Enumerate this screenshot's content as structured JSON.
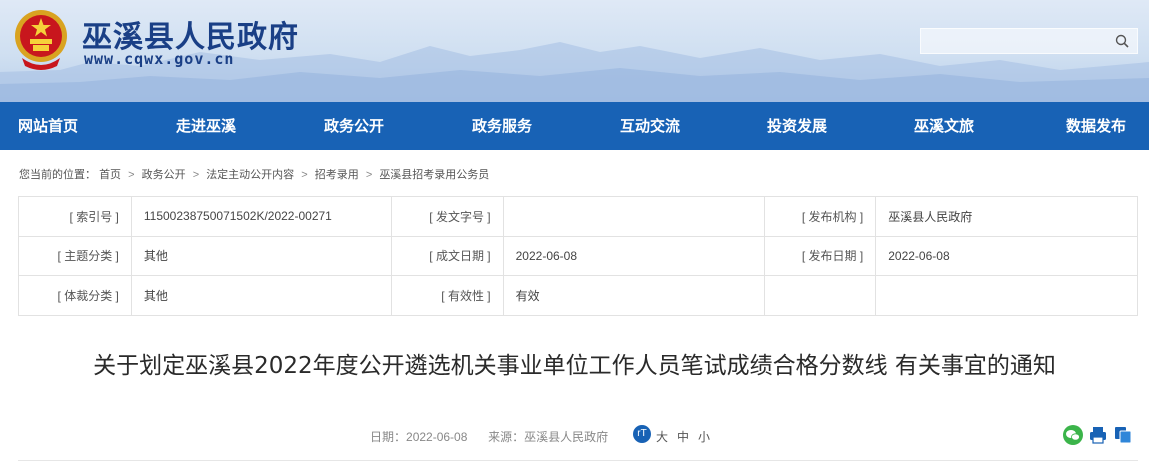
{
  "header": {
    "site_title": "巫溪县人民政府",
    "site_url": "www.cqwx.gov.cn",
    "search_placeholder": ""
  },
  "nav": {
    "items": [
      "网站首页",
      "走进巫溪",
      "政务公开",
      "政务服务",
      "互动交流",
      "投资发展",
      "巫溪文旅",
      "数据发布"
    ]
  },
  "breadcrumb": {
    "prefix": "您当前的位置：",
    "items": [
      "首页",
      "政务公开",
      "法定主动公开内容",
      "招考录用",
      "巫溪县招考录用公务员"
    ]
  },
  "info": {
    "index_label": "[ 索引号 ]",
    "index_value": "11500238750071502K/2022-00271",
    "doc_no_label": "[ 发文字号 ]",
    "doc_no_value": "",
    "publisher_label": "[ 发布机构 ]",
    "publisher_value": "巫溪县人民政府",
    "topic_label": "[ 主题分类 ]",
    "topic_value": "其他",
    "created_label": "[ 成文日期 ]",
    "created_value": "2022-06-08",
    "published_label": "[ 发布日期 ]",
    "published_value": "2022-06-08",
    "genre_label": "[ 体裁分类 ]",
    "genre_value": "其他",
    "validity_label": "[ 有效性 ]",
    "validity_value": "有效"
  },
  "article": {
    "title": "关于划定巫溪县2022年度公开遴选机关事业单位工作人员笔试成绩合格分数线 有关事宜的通知",
    "date_label": "日期：",
    "date_value": "2022-06-08",
    "source_label": "来源：",
    "source_value": "巫溪县人民政府",
    "font_toggle": "rT",
    "font_large": "大",
    "font_medium": "中",
    "font_small": "小"
  },
  "colors": {
    "nav_bg": "#1862b5",
    "title_blue": "#1a3f86",
    "wechat_green": "#3bb44a",
    "print_blue": "#1862b5"
  },
  "icons": [
    "emblem-icon",
    "search-icon",
    "font-size-icon",
    "wechat-icon",
    "print-icon",
    "copy-icon"
  ]
}
